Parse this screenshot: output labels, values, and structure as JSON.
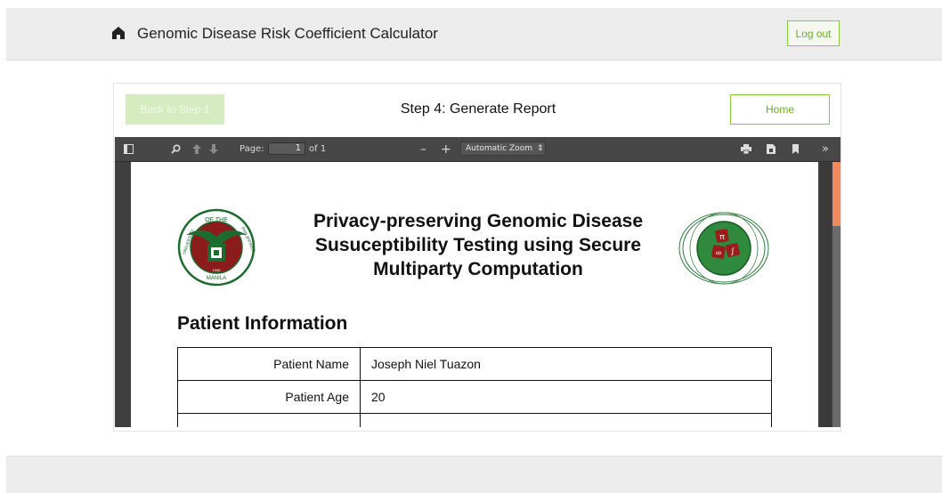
{
  "header": {
    "title": "Genomic Disease Risk Coefficient Calculator",
    "logout_label": "Log out"
  },
  "panel": {
    "back_label": "Back to Step 1",
    "step_title": "Step 4: Generate Report",
    "home_label": "Home"
  },
  "viewer": {
    "page_label": "Page:",
    "page_value": "1",
    "page_total": "of 1",
    "zoom_value": "Automatic Zoom"
  },
  "document": {
    "title_lines": [
      "Privacy-preserving Genomic Disease",
      "Susuceptibility Testing using Secure",
      "Multiparty Computation"
    ],
    "left_seal": {
      "top_text": "OF THE",
      "left_text": "UNIVERSITY",
      "right_text": "PHILIPPINES",
      "bottom_text": "MANILA",
      "year": "1908"
    },
    "section_heading": "Patient Information",
    "rows": [
      {
        "label": "Patient Name",
        "value": "Joseph Niel Tuazon"
      },
      {
        "label": "Patient Age",
        "value": "20"
      },
      {
        "label": "",
        "value": ""
      }
    ]
  },
  "colors": {
    "accent_green": "#8cc63f",
    "scroll_thumb": "#f08a5d"
  }
}
